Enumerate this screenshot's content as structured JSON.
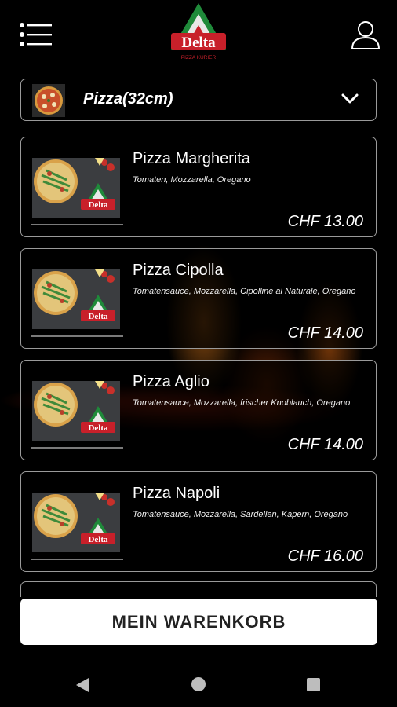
{
  "header": {
    "logo_text": "Delta",
    "logo_subtext": "PIZZA KURIER"
  },
  "category": {
    "selected": "Pizza(32cm)"
  },
  "products": [
    {
      "name": "Pizza Margherita",
      "description": "Tomaten, Mozzarella, Oregano",
      "price": "CHF 13.00"
    },
    {
      "name": "Pizza Cipolla",
      "description": "Tomatensauce, Mozzarella, Cipolline al Naturale, Oregano",
      "price": "CHF 14.00"
    },
    {
      "name": "Pizza Aglio",
      "description": "Tomatensauce, Mozzarella, frischer Knoblauch, Oregano",
      "price": "CHF 14.00"
    },
    {
      "name": "Pizza Napoli",
      "description": "Tomatensauce, Mozzarella, Sardellen, Kapern, Oregano",
      "price": "CHF 16.00"
    }
  ],
  "cart_button": {
    "label": "MEIN WARENKORB"
  },
  "icons": {
    "menu": "menu-icon",
    "user": "user-icon",
    "chevron": "chevron-down-icon",
    "back": "nav-back-icon",
    "home": "nav-home-icon",
    "recent": "nav-recent-icon"
  }
}
